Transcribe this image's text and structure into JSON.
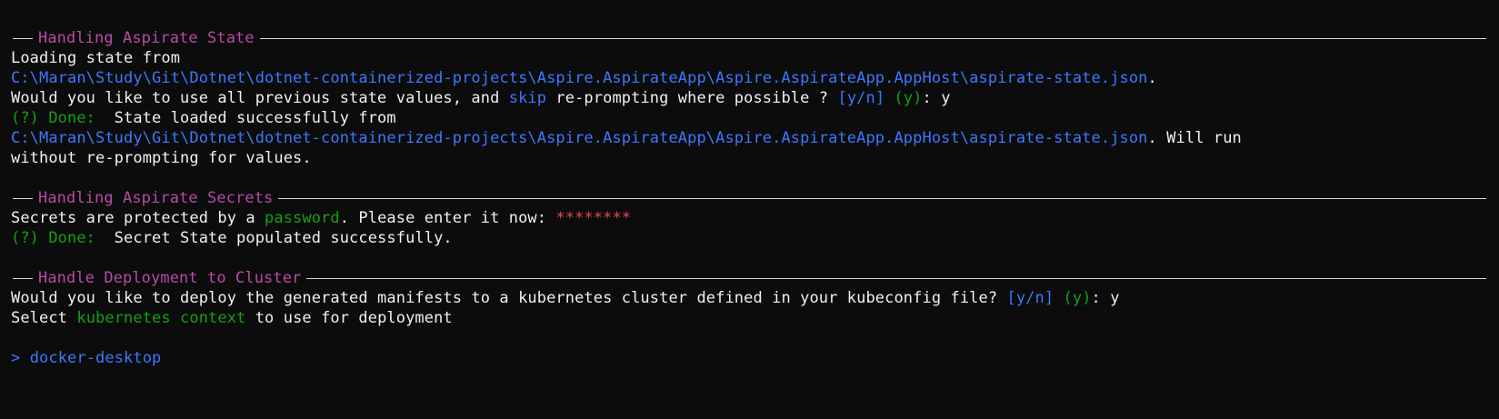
{
  "sections": {
    "state": {
      "title": "Handling Aspirate State",
      "loading_label": "Loading state from",
      "path": "C:\\Maran\\Study\\Git\\Dotnet\\dotnet-containerized-projects\\Aspire.AspirateApp\\Aspire.AspirateApp.AppHost\\aspirate-state.json",
      "path_suffix": ".",
      "question_prefix": "Would you like to use all previous state values, and ",
      "question_keyword": "skip",
      "question_suffix": " re-prompting where possible ? ",
      "choices": "[y/n]",
      "default_choice": "(y)",
      "answer_sep": ": ",
      "answer": "y",
      "done_label": "(?) Done:",
      "done_text": "  State loaded successfully from",
      "done_path": "C:\\Maran\\Study\\Git\\Dotnet\\dotnet-containerized-projects\\Aspire.AspirateApp\\Aspire.AspirateApp.AppHost\\aspirate-state.json",
      "done_path_suffix": ". Will run",
      "done_continuation": "without re-prompting for values."
    },
    "secrets": {
      "title": "Handling Aspirate Secrets",
      "prompt_prefix": "Secrets are protected by a ",
      "prompt_keyword": "password",
      "prompt_suffix": ". Please enter it now: ",
      "masked_input": "********",
      "done_label": "(?) Done:",
      "done_text": "  Secret State populated successfully."
    },
    "deploy": {
      "title": "Handle Deployment to Cluster",
      "question": "Would you like to deploy the generated manifests to a kubernetes cluster defined in your kubeconfig file? ",
      "choices": "[y/n]",
      "default_choice": "(y)",
      "answer_sep": ": ",
      "answer": "y",
      "select_prefix": "Select ",
      "select_keyword": "kubernetes context",
      "select_suffix": " to use for deployment",
      "selection_pointer": ">",
      "selection_option": "docker-desktop"
    }
  },
  "colors": {
    "background": "#0c0c0c",
    "text": "#cccccc",
    "title": "#b84aa8",
    "path": "#3b78ff",
    "success": "#13a10e",
    "masked": "#e74856"
  }
}
